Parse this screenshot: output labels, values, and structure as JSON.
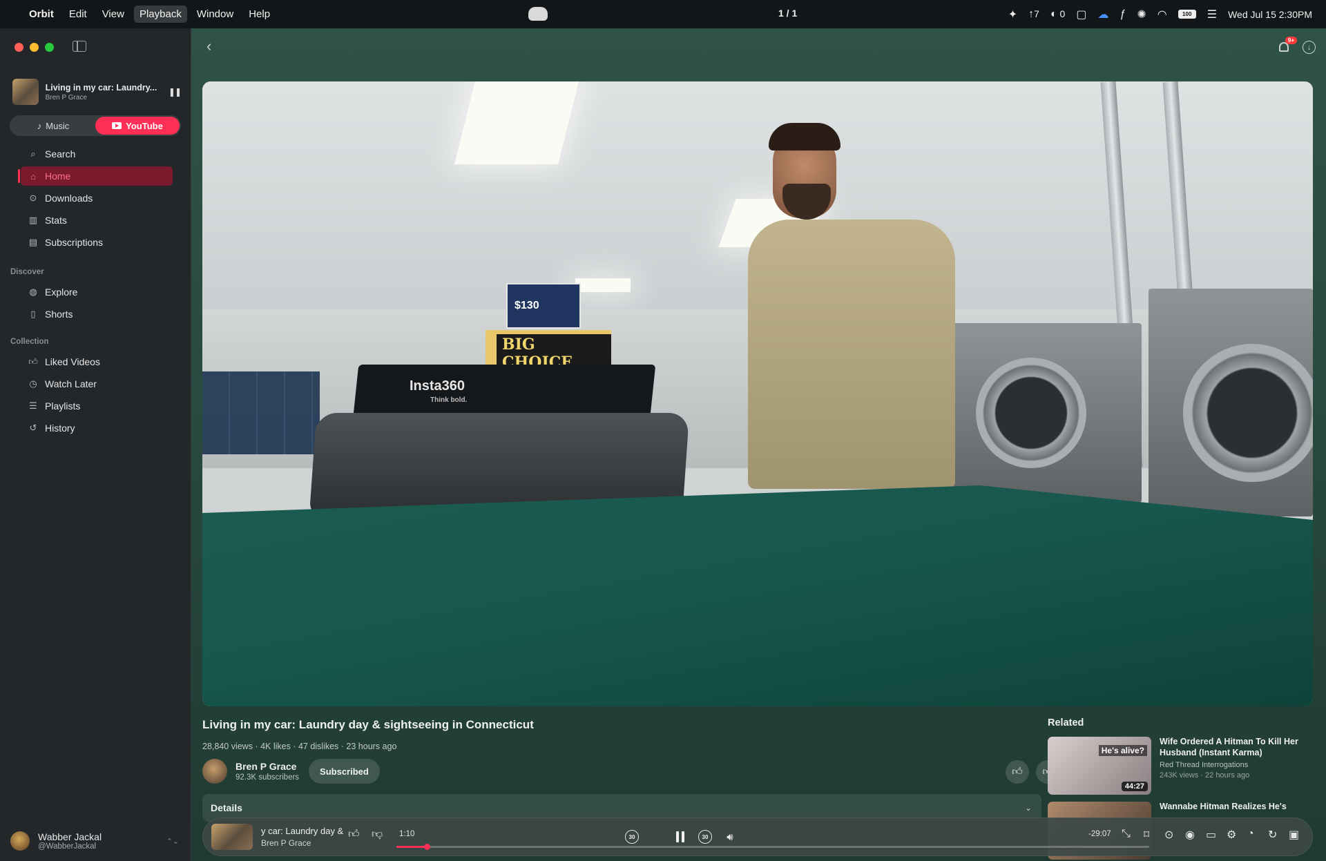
{
  "menubar": {
    "app_name": "Orbit",
    "items": [
      "Edit",
      "View",
      "Playback",
      "Window",
      "Help"
    ],
    "active_item": "Playback",
    "counter": "1 / 1",
    "status_items": [
      {
        "icon": "sparkle-icon",
        "label": ""
      },
      {
        "icon": "arrow-up-icon",
        "label": "7"
      },
      {
        "icon": "contacts-icon",
        "label": "0"
      },
      {
        "icon": "message-icon",
        "label": ""
      },
      {
        "icon": "cloud-icon",
        "label": ""
      },
      {
        "icon": "script-icon",
        "label": ""
      },
      {
        "icon": "openai-icon",
        "label": ""
      },
      {
        "icon": "wifi-icon",
        "label": ""
      }
    ],
    "battery": "100",
    "datetime": "Wed Jul 15  2:30PM"
  },
  "sidebar": {
    "now_playing": {
      "title": "Living in my car: Laundry...",
      "artist": "Bren P Grace"
    },
    "segment": {
      "music": "Music",
      "youtube": "YouTube",
      "selected": "YouTube"
    },
    "main_items": [
      {
        "label": "Search",
        "icon": "search-icon"
      },
      {
        "label": "Home",
        "icon": "home-icon",
        "active": true
      },
      {
        "label": "Downloads",
        "icon": "download-icon"
      },
      {
        "label": "Stats",
        "icon": "stats-icon"
      },
      {
        "label": "Subscriptions",
        "icon": "subscriptions-icon"
      }
    ],
    "discover_label": "Discover",
    "discover_items": [
      {
        "label": "Explore",
        "icon": "globe-icon"
      },
      {
        "label": "Shorts",
        "icon": "shorts-icon"
      }
    ],
    "collection_label": "Collection",
    "collection_items": [
      {
        "label": "Liked Videos",
        "icon": "thumbs-up-icon"
      },
      {
        "label": "Watch Later",
        "icon": "clock-icon"
      },
      {
        "label": "Playlists",
        "icon": "playlist-icon"
      },
      {
        "label": "History",
        "icon": "history-icon"
      }
    ],
    "profile": {
      "name": "Wabber Jackal",
      "handle": "@WabberJackal"
    }
  },
  "header": {
    "notification_badge": "9+"
  },
  "video": {
    "frame_text": {
      "case_brand": "Insta360",
      "case_tagline": "Think bold.",
      "sign": "$130",
      "store_sign": "BIG CHOICE"
    },
    "title": "Living in my car: Laundry day & sightseeing in Connecticut",
    "stats": "28,840 views · 4K likes · 47 dislikes · 23 hours ago",
    "channel": {
      "name": "Bren P Grace",
      "subscribers": "92.3K subscribers",
      "subscribe_label": "Subscribed"
    },
    "details_label": "Details"
  },
  "related": {
    "heading": "Related",
    "items": [
      {
        "title": "Wife Ordered A Hitman To Kill Her Husband (Instant Karma)",
        "channel": "Red Thread Interrogations",
        "meta": "243K views · 22 hours ago",
        "duration": "44:27",
        "thumb_text": "He's alive?"
      },
      {
        "title": "Wannabe Hitman Realizes He's",
        "channel": "",
        "meta": "",
        "duration": "",
        "thumb_text": ""
      }
    ]
  },
  "player": {
    "title": "y car: Laundry day &",
    "artist": "Bren P Grace",
    "elapsed": "1:10",
    "remaining": "-29:07",
    "progress": 0.04,
    "skip_back": "30",
    "skip_forward": "30"
  },
  "colors": {
    "accent": "#ff2f55",
    "main_bg": "#2f5246",
    "sidebar_bg": "#23272a"
  }
}
